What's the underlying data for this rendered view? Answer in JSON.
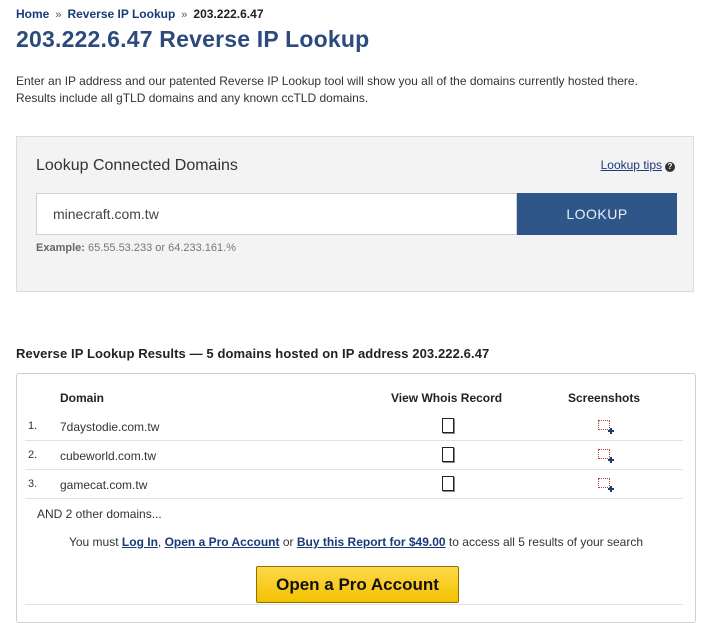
{
  "breadcrumb": {
    "home": "Home",
    "sep": "»",
    "lookup": "Reverse IP Lookup",
    "current": "203.222.6.47"
  },
  "page_title": "203.222.6.47 Reverse IP Lookup",
  "intro": {
    "line1": "Enter an IP address and our patented Reverse IP Lookup tool will show you all of the domains currently hosted there.",
    "line2": "Results include all gTLD domains and any known ccTLD domains."
  },
  "lookup": {
    "title": "Lookup Connected Domains",
    "tips_label": "Lookup tips",
    "help_glyph": "?",
    "input_value": "minecraft.com.tw",
    "button_label": "LOOKUP",
    "example_label": "Example:",
    "example_text": "65.55.53.233 or 64.233.161.%"
  },
  "results": {
    "heading": "Reverse IP Lookup Results — 5 domains hosted on IP address 203.222.6.47",
    "columns": {
      "domain": "Domain",
      "whois": "View Whois Record",
      "screenshots": "Screenshots"
    },
    "rows": [
      {
        "num": "1.",
        "domain": "7daystodie.com.tw"
      },
      {
        "num": "2.",
        "domain": "cubeworld.com.tw"
      },
      {
        "num": "3.",
        "domain": "gamecat.com.tw"
      }
    ],
    "other": "AND 2 other domains...",
    "pro_line": {
      "prefix": "You must",
      "login": "Log In",
      "comma": ",",
      "open_pro": "Open a Pro Account",
      "or": "or",
      "buy": "Buy this Report for $49.00",
      "suffix": "to access all 5 results of your search"
    },
    "pro_button": "Open a Pro Account"
  },
  "colors": {
    "title": "#2c4a7c",
    "link": "#1b3a78",
    "lookup_button": "#2f5689",
    "pro_button": "#f2c200"
  },
  "icons": {
    "whois": "document-icon",
    "screenshot": "screenshot-icon",
    "help": "help-icon"
  }
}
